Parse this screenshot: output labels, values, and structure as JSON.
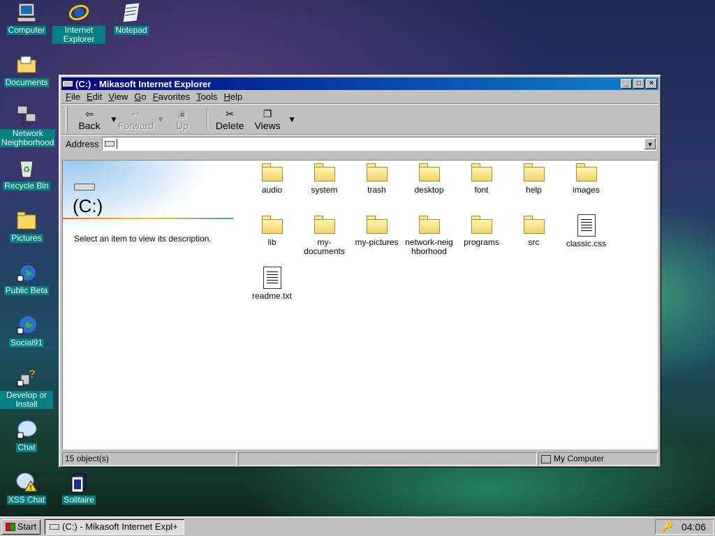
{
  "desktop": {
    "icons": [
      {
        "label": "Computer",
        "icon": "computer-icon"
      },
      {
        "label": "Internet Explorer",
        "icon": "internet-explorer-icon"
      },
      {
        "label": "Notepad",
        "icon": "notepad-icon"
      },
      {
        "label": "Documents",
        "icon": "documents-folder-icon"
      },
      {
        "label": "Network Neighborhood",
        "icon": "network-icon"
      },
      {
        "label": "Recycle Bin",
        "icon": "recycle-bin-icon"
      },
      {
        "label": "Pictures",
        "icon": "pictures-folder-icon"
      },
      {
        "label": "Public Beta",
        "icon": "public-beta-icon"
      },
      {
        "label": "Social91",
        "icon": "globe-icon"
      },
      {
        "label": "Develop or Install",
        "icon": "help-icon"
      },
      {
        "label": "Chat",
        "icon": "chat-icon"
      },
      {
        "label": "XSS Chat",
        "icon": "xss-chat-icon"
      },
      {
        "label": "Solitaire",
        "icon": "solitaire-icon"
      }
    ]
  },
  "window": {
    "title": "(C:) - Mikasoft Internet Explorer",
    "controls": {
      "minimize": "_",
      "maximize": "□",
      "close": "×"
    },
    "menu": [
      "File",
      "Edit",
      "View",
      "Go",
      "Favorites",
      "Tools",
      "Help"
    ],
    "toolbar": {
      "back": "Back",
      "forward": "Forward",
      "up": "Up",
      "delete": "Delete",
      "views": "Views"
    },
    "address": {
      "label": "Address",
      "value": ""
    },
    "side_panel": {
      "title": "(C:)",
      "description": "Select an item to view its description."
    },
    "files": [
      {
        "name": "audio",
        "type": "folder"
      },
      {
        "name": "system",
        "type": "folder"
      },
      {
        "name": "trash",
        "type": "folder"
      },
      {
        "name": "desktop",
        "type": "folder"
      },
      {
        "name": "font",
        "type": "folder"
      },
      {
        "name": "help",
        "type": "folder"
      },
      {
        "name": "images",
        "type": "folder"
      },
      {
        "name": "lib",
        "type": "folder"
      },
      {
        "name": "my-documents",
        "type": "folder"
      },
      {
        "name": "my-pictures",
        "type": "folder"
      },
      {
        "name": "network-neighborhood",
        "type": "folder"
      },
      {
        "name": "programs",
        "type": "folder"
      },
      {
        "name": "src",
        "type": "folder"
      },
      {
        "name": "classic.css",
        "type": "file"
      },
      {
        "name": "readme.txt",
        "type": "file"
      }
    ],
    "status": {
      "objects": "15 object(s)",
      "location": "My Computer"
    }
  },
  "taskbar": {
    "start_label": "Start",
    "task_label": "(C:) - Mikasoft Internet Expl+",
    "clock": "04:06"
  },
  "colors": {
    "title_start": "#000080",
    "title_end": "#1084d0",
    "face": "#c0c0c0",
    "selection": "#008080"
  }
}
